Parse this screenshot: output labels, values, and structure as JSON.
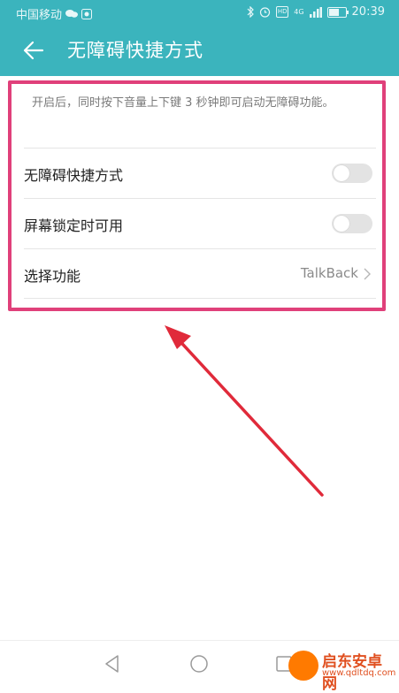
{
  "status_bar": {
    "carrier": "中国移动",
    "hd_badge": "HD",
    "network_badge": "4G",
    "time": "20:39",
    "battery_level": 0.6
  },
  "app_bar": {
    "title": "无障碍快捷方式",
    "back_icon": "arrow-left-icon"
  },
  "content": {
    "description": "开启后，同时按下音量上下键 3 秒钟即可启动无障碍功能。",
    "rows": [
      {
        "label": "无障碍快捷方式",
        "type": "toggle",
        "on": false
      },
      {
        "label": "屏幕锁定时可用",
        "type": "toggle",
        "on": false
      },
      {
        "label": "选择功能",
        "type": "link",
        "value": "TalkBack"
      }
    ]
  },
  "colors": {
    "accent": "#3bb4bd",
    "highlight_border": "#e0407a",
    "annotation_arrow": "#e02a3a"
  },
  "nav_bar": {
    "icons": [
      "back-triangle-icon",
      "home-circle-icon",
      "recents-square-icon"
    ]
  },
  "watermark": {
    "name": "启东安卓网",
    "url": "www.qdltdq.com"
  }
}
